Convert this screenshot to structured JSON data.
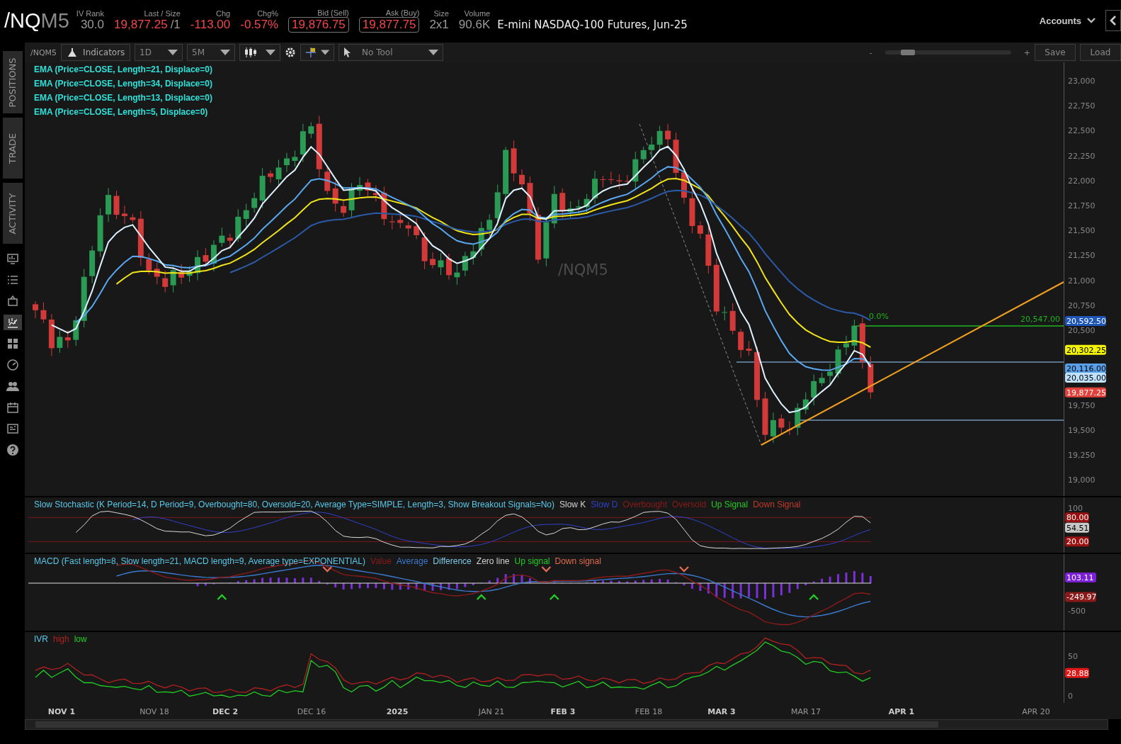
{
  "header": {
    "symbol_root": "/NQ",
    "symbol_month": "M5",
    "quotes": [
      {
        "label": "IV Rank",
        "value": "30.0",
        "negative": false,
        "boxed": false
      },
      {
        "label": "Last / Size",
        "value": "19,877.25",
        "size": "/1",
        "negative": true,
        "boxed": false
      },
      {
        "label": "Chg",
        "value": "-113.00",
        "negative": true,
        "boxed": false
      },
      {
        "label": "Chg%",
        "value": "-0.57%",
        "negative": true,
        "boxed": false
      },
      {
        "label": "Bid (Sell)",
        "value": "19,876.75",
        "negative": true,
        "boxed": true
      },
      {
        "label": "Ask (Buy)",
        "value": "19,877.75",
        "negative": true,
        "boxed": true
      },
      {
        "label": "Size",
        "value": "2x1",
        "negative": false,
        "boxed": false
      },
      {
        "label": "Volume",
        "value": "90.6K",
        "negative": false,
        "boxed": false
      }
    ],
    "description": "E-mini NASDAQ-100 Futures, Jun-25",
    "accounts_label": "Accounts"
  },
  "side_tabs": [
    {
      "label": "POSITIONS"
    },
    {
      "label": "TRADE"
    },
    {
      "label": "ACTIVITY"
    }
  ],
  "side_icons": [
    {
      "kind": "monitor",
      "selected": false
    },
    {
      "kind": "list",
      "selected": false
    },
    {
      "kind": "box",
      "selected": false
    },
    {
      "kind": "chart",
      "selected": true
    },
    {
      "kind": "grid",
      "selected": false
    },
    {
      "kind": "gauge",
      "selected": false
    },
    {
      "kind": "people",
      "selected": false
    },
    {
      "kind": "calendar",
      "selected": false
    },
    {
      "kind": "news",
      "selected": false
    },
    {
      "kind": "help",
      "selected": false
    }
  ],
  "toolbar": {
    "symbol": "/NQM5",
    "indicators_label": "Indicators",
    "timeframe": "1D",
    "aggregation": "5M",
    "drawing_tool": "No Tool",
    "zoom": {
      "minus": "-",
      "plus": "+",
      "level": 0.15
    },
    "save_label": "Save",
    "load_label": "Load"
  },
  "price_panel": {
    "watermark": "/NQM5",
    "studies": [
      "EMA (Price=CLOSE, Length=21, Displace=0)",
      "EMA (Price=CLOSE, Length=34, Displace=0)",
      "EMA (Price=CLOSE, Length=13, Displace=0)",
      "EMA (Price=CLOSE, Length=5, Displace=0)"
    ],
    "axis_labels": [
      "23,000",
      "22,750",
      "22,500",
      "22,250",
      "22,000",
      "21,750",
      "21,500",
      "21,250",
      "21,000",
      "20,750",
      "20,500",
      "19,750",
      "19,500",
      "19,250",
      "19,000"
    ],
    "badges": [
      {
        "text": "20,592.50",
        "color": "#1e56b8"
      },
      {
        "text": "20,302.25",
        "color": "#f5f20a"
      },
      {
        "text": "20,116.00",
        "color": "#5aa0e8"
      },
      {
        "text": "20,035.00",
        "color": "#bfe3ff"
      },
      {
        "text": "19,877.25",
        "color": "#e0413a"
      }
    ],
    "fib_label": "0.0%",
    "level_label": "20,547.00"
  },
  "stochastic_panel": {
    "legend": [
      {
        "text": "Slow Stochastic (K Period=14, D Period=9, Overbought=80, Oversold=20, Average Type=SIMPLE, Length=3, Show Breakout Signals=No)",
        "color": "#58c8e8"
      },
      {
        "text": "Slow K",
        "color": "#d0d0d0"
      },
      {
        "text": "Slow D",
        "color": "#3040c8"
      },
      {
        "text": "Overbought",
        "color": "#8b1a1a"
      },
      {
        "text": "Oversold",
        "color": "#8b1a1a"
      },
      {
        "text": "Up Signal",
        "color": "#22cc22"
      },
      {
        "text": "Down Signal",
        "color": "#c0392b"
      }
    ],
    "axis_labels": [
      "100"
    ],
    "badges": [
      {
        "text": "80.00",
        "color": "#9b1010"
      },
      {
        "text": "54.51",
        "color": "#c8c8c8"
      },
      {
        "text": "20.00",
        "color": "#9b1010"
      }
    ]
  },
  "macd_panel": {
    "legend": [
      {
        "text": "MACD (Fast length=8, Slow length=21, MACD length=9, Average type=EXPONENTIAL)",
        "color": "#58c8e8"
      },
      {
        "text": "Value",
        "color": "#8b1a1a"
      },
      {
        "text": "Average",
        "color": "#3a7ad0"
      },
      {
        "text": "Difference",
        "color": "#7ec8e8"
      },
      {
        "text": "Zero line",
        "color": "#d0d0d0"
      },
      {
        "text": "Up signal",
        "color": "#22cc22"
      },
      {
        "text": "Down signal",
        "color": "#e06a50"
      }
    ],
    "axis_labels": [
      "-500"
    ],
    "badges": [
      {
        "text": "103.11",
        "color": "#7a1fd6"
      },
      {
        "text": "-249.97",
        "color": "#8b1a1a"
      }
    ]
  },
  "ivr_panel": {
    "legend": [
      {
        "text": "IVR",
        "color": "#58c8e8"
      },
      {
        "text": "high",
        "color": "#b02020"
      },
      {
        "text": "low",
        "color": "#22cc22"
      }
    ],
    "axis_labels": [
      "50",
      "0"
    ],
    "badges": [
      {
        "text": "28.88",
        "color": "#e01818"
      }
    ]
  },
  "date_axis": [
    {
      "label": "NOV 1",
      "major": true
    },
    {
      "label": "NOV 18",
      "major": false
    },
    {
      "label": "DEC 2",
      "major": true
    },
    {
      "label": "DEC 16",
      "major": false
    },
    {
      "label": "2025",
      "major": true
    },
    {
      "label": "JAN 21",
      "major": false
    },
    {
      "label": "FEB 3",
      "major": true
    },
    {
      "label": "FEB 18",
      "major": false
    },
    {
      "label": "MAR 3",
      "major": true
    },
    {
      "label": "MAR 17",
      "major": false
    },
    {
      "label": "APR 1",
      "major": true
    },
    {
      "label": "APR 20",
      "major": false
    }
  ]
}
